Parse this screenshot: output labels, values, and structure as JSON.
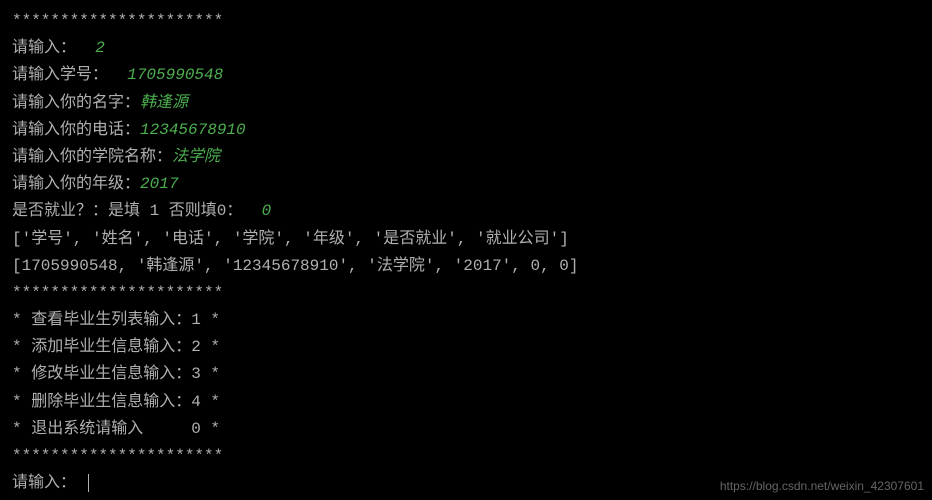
{
  "terminal": {
    "separator": "**********************",
    "prompts": {
      "input": "请输入：",
      "student_id": "请输入学号：",
      "name": "请输入你的名字：",
      "phone": "请输入你的电话：",
      "college": "请输入你的学院名称：",
      "grade": "请输入你的年级：",
      "employment": "是否就业？：是填 1 否则填0："
    },
    "inputs": {
      "choice": "2",
      "student_id": "1705990548",
      "name": "韩逢源",
      "phone": "12345678910",
      "college": "法学院",
      "grade": "2017",
      "employment": "0"
    },
    "output": {
      "headers": "['学号', '姓名', '电话', '学院', '年级', '是否就业', '就业公司']",
      "data": "[1705990548, '韩逢源', '12345678910', '法学院', '2017', 0, 0]"
    },
    "menu": {
      "item1": "* 查看毕业生列表输入：1 *",
      "item2": "* 添加毕业生信息输入：2 *",
      "item3": "* 修改毕业生信息输入：3 *",
      "item4": "* 删除毕业生信息输入：4 *",
      "item5": "* 退出系统请输入     0 *"
    },
    "final_prompt": "请输入："
  },
  "watermark": "https://blog.csdn.net/weixin_42307601"
}
